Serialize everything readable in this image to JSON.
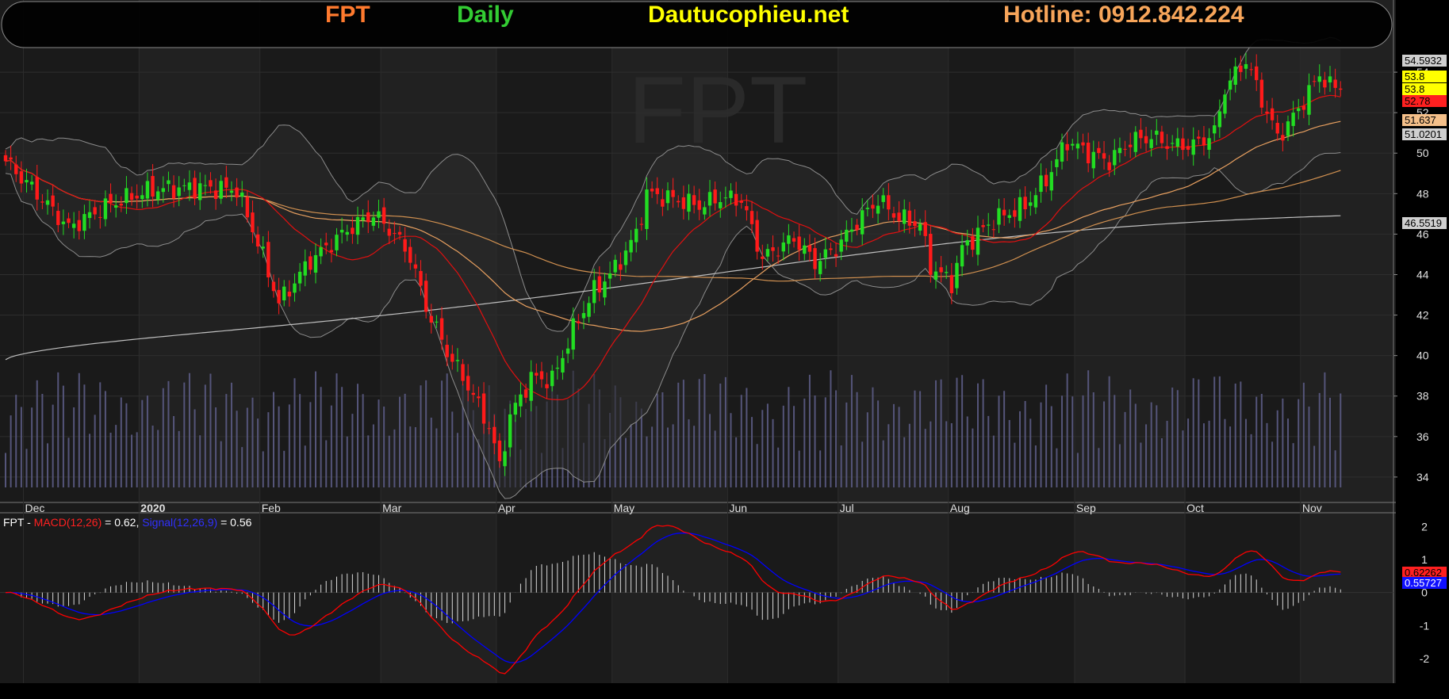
{
  "header": {
    "symbol": "FPT",
    "timeframe": "Daily",
    "site": "Dautucophieu.net",
    "hotline": "Hotline: 0912.842.224",
    "colors": {
      "symbol": "#ff7a2e",
      "timeframe": "#33cc33",
      "site": "#ffff00",
      "hotline": "#f7a55a"
    }
  },
  "watermark": "FPT",
  "price_axis": {
    "ticks": [
      34,
      36,
      38,
      40,
      42,
      44,
      46,
      48,
      50,
      52,
      54
    ],
    "range": [
      32.9,
      56
    ]
  },
  "price_tags": [
    {
      "text": "54.5932",
      "bg": "#cfcfcf",
      "fg": "#000",
      "value": 54.59
    },
    {
      "text": "53.8",
      "bg": "#ffff00",
      "fg": "#000",
      "value": 53.8
    },
    {
      "text": "53.8",
      "bg": "#ffff00",
      "fg": "#000",
      "value": 53.2
    },
    {
      "text": "52.78",
      "bg": "#ff2020",
      "fg": "#000",
      "value": 52.6
    },
    {
      "text": "51.637",
      "bg": "#f5c08a",
      "fg": "#000",
      "value": 51.64
    },
    {
      "text": "51.0201",
      "bg": "#cfcfcf",
      "fg": "#000",
      "value": 50.95
    },
    {
      "text": "46.5519",
      "bg": "#cfcfcf",
      "fg": "#000",
      "value": 46.55
    }
  ],
  "time_axis": {
    "labels": [
      "Dec",
      "2020",
      "Feb",
      "Mar",
      "Apr",
      "May",
      "Jun",
      "Jul",
      "Aug",
      "Sep",
      "Oct",
      "Nov"
    ],
    "bold": [
      false,
      true,
      false,
      false,
      false,
      false,
      false,
      false,
      false,
      false,
      false,
      false
    ],
    "bar_index": [
      4,
      26,
      49,
      72,
      94,
      116,
      138,
      159,
      180,
      204,
      225,
      247
    ]
  },
  "macd": {
    "legend": {
      "symbol": "FPT",
      "dash": " - ",
      "macd_label": "MACD(12,26)",
      "macd_value": " = 0.62, ",
      "signal_label": "Signal(12,26,9)",
      "signal_value": " = 0.56"
    },
    "axis_ticks": [
      -2,
      -1,
      0,
      1,
      2
    ],
    "range": [
      -2.75,
      2.35
    ],
    "tags": [
      {
        "text": "0.62262",
        "bg": "#ff2020",
        "fg": "#000",
        "value": 0.62
      },
      {
        "text": "0.55727",
        "bg": "#1010ff",
        "fg": "#fff",
        "value": 0.3
      }
    ]
  },
  "chart_data": {
    "type": "candlestick",
    "symbol": "FPT",
    "timeframe": "Daily",
    "y_range": [
      32.9,
      56
    ],
    "close_anchors": [
      [
        0,
        49.6
      ],
      [
        6,
        48.0
      ],
      [
        12,
        46.3
      ],
      [
        20,
        47.5
      ],
      [
        28,
        48.2
      ],
      [
        36,
        48.3
      ],
      [
        44,
        48.2
      ],
      [
        48,
        45.6
      ],
      [
        52,
        42.6
      ],
      [
        58,
        44.7
      ],
      [
        65,
        46.2
      ],
      [
        70,
        47.0
      ],
      [
        74,
        46.0
      ],
      [
        77,
        44.9
      ],
      [
        80,
        42.4
      ],
      [
        84,
        40.2
      ],
      [
        88,
        38.5
      ],
      [
        92,
        36.5
      ],
      [
        94,
        34.5
      ],
      [
        96,
        37.0
      ],
      [
        100,
        38.9
      ],
      [
        104,
        38.8
      ],
      [
        106,
        40.0
      ],
      [
        108,
        41.3
      ],
      [
        112,
        43.2
      ],
      [
        116,
        44.3
      ],
      [
        120,
        46.0
      ],
      [
        122,
        48.0
      ],
      [
        126,
        47.8
      ],
      [
        132,
        47.4
      ],
      [
        136,
        47.8
      ],
      [
        140,
        47.7
      ],
      [
        144,
        44.8
      ],
      [
        150,
        45.8
      ],
      [
        154,
        44.6
      ],
      [
        158,
        45.3
      ],
      [
        162,
        46.6
      ],
      [
        166,
        47.7
      ],
      [
        170,
        46.8
      ],
      [
        174,
        46.5
      ],
      [
        176,
        44.4
      ],
      [
        180,
        43.6
      ],
      [
        182,
        45.3
      ],
      [
        188,
        46.7
      ],
      [
        194,
        47.4
      ],
      [
        198,
        48.7
      ],
      [
        202,
        50.6
      ],
      [
        206,
        50.0
      ],
      [
        210,
        49.6
      ],
      [
        214,
        50.6
      ],
      [
        218,
        50.8
      ],
      [
        222,
        50.4
      ],
      [
        226,
        50.4
      ],
      [
        230,
        51.0
      ],
      [
        232,
        53.2
      ],
      [
        236,
        54.6
      ],
      [
        238,
        53.3
      ],
      [
        240,
        52.0
      ],
      [
        242,
        50.8
      ],
      [
        244,
        51.4
      ],
      [
        246,
        52.2
      ],
      [
        248,
        53.0
      ],
      [
        250,
        53.9
      ],
      [
        252,
        53.3
      ],
      [
        254,
        53.3
      ]
    ],
    "moving_averages": [
      {
        "name": "SMA20",
        "color": "#e01010"
      },
      {
        "name": "SMA50",
        "color": "#e8a060"
      },
      {
        "name": "SMA100",
        "color": "#d09050"
      },
      {
        "name": "SMA200",
        "color": "#c0c0c0"
      }
    ],
    "bollinger": {
      "period": 20,
      "stdev": 2,
      "color": "#8c8c8c"
    },
    "macd_params": {
      "fast": 12,
      "slow": 26,
      "signal": 9,
      "macd_color": "#ff0000",
      "signal_color": "#0000ff"
    },
    "last_values": {
      "macd": 0.62,
      "signal": 0.56
    }
  }
}
